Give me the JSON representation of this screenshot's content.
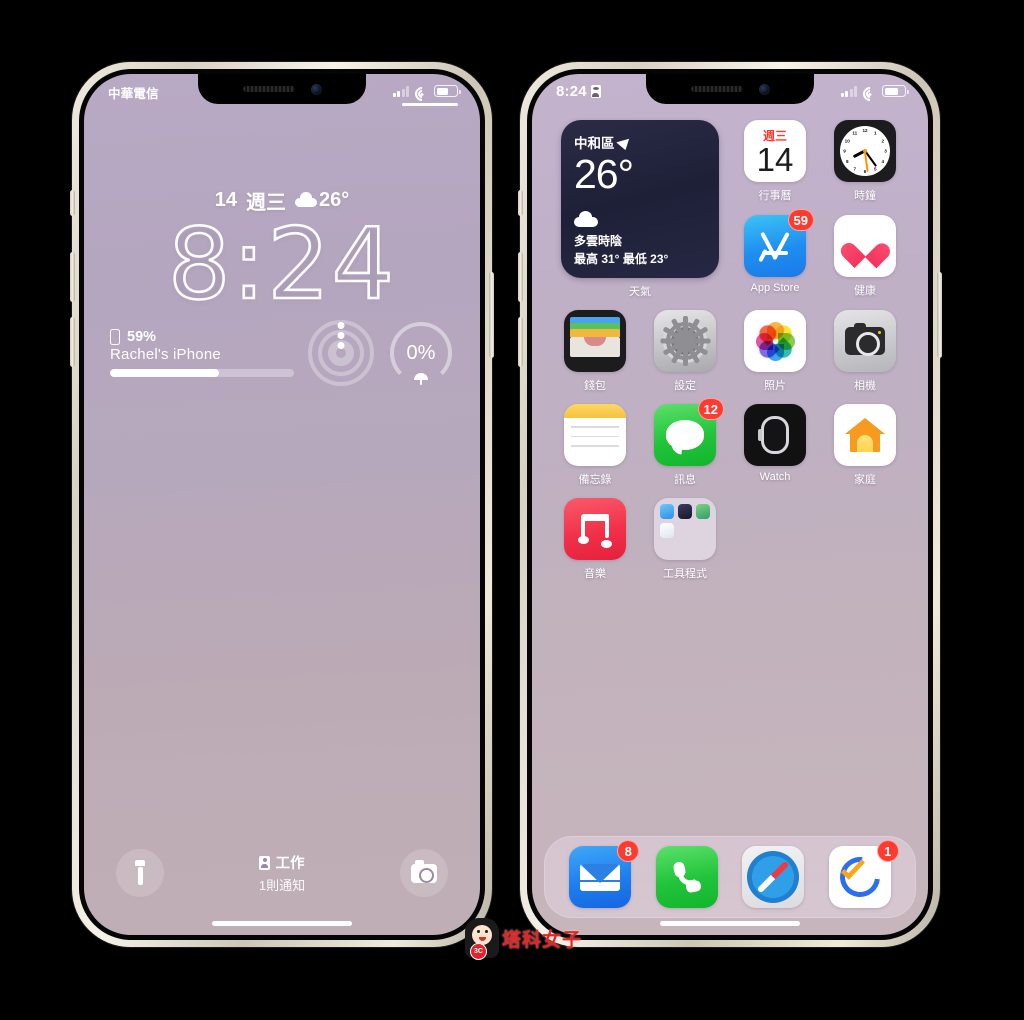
{
  "watermark": {
    "text": "塔科女子",
    "badge": "3C"
  },
  "lock_screen": {
    "status_bar": {
      "carrier": "中華電信",
      "battery_level_pct": 59
    },
    "date_line": {
      "day": "14",
      "weekday": "週三",
      "temp": "26°",
      "condition_icon": "cloud-icon"
    },
    "clock": "8:24",
    "widgets": {
      "battery": {
        "percent": "59%",
        "device_name": "Rachel's  iPhone",
        "fill_pct": 59
      },
      "rings": {
        "label": "activity-rings"
      },
      "rain": {
        "percent": "0%",
        "icon": "umbrella-icon"
      }
    },
    "bottom": {
      "flashlight_label": "flashlight",
      "camera_label": "camera",
      "focus_name": "工作",
      "notification_count_text": "1則通知"
    }
  },
  "home_screen": {
    "status_bar": {
      "time": "8:24",
      "lock_icon": "focus-lock-icon",
      "battery_level_pct": 72
    },
    "weather_widget": {
      "city": "中和區",
      "location_icon": "location-arrow-icon",
      "temperature": "26°",
      "condition_icon": "cloud-icon",
      "condition": "多雲時陰",
      "high_low": "最高 31° 最低 23°",
      "label": "天氣"
    },
    "rows": [
      [
        {
          "name": "calendar",
          "label": "行事曆",
          "weekday": "週三",
          "day": "14",
          "badge": null
        },
        {
          "name": "clock",
          "label": "時鐘",
          "badge": null
        }
      ],
      [
        {
          "name": "app-store",
          "label": "App Store",
          "badge": "59"
        },
        {
          "name": "health",
          "label": "健康",
          "badge": null
        }
      ],
      [
        {
          "name": "wallet",
          "label": "錢包",
          "badge": null
        },
        {
          "name": "settings",
          "label": "設定",
          "badge": null
        },
        {
          "name": "photos",
          "label": "照片",
          "badge": null
        },
        {
          "name": "camera",
          "label": "相機",
          "badge": null
        }
      ],
      [
        {
          "name": "notes",
          "label": "備忘錄",
          "badge": null
        },
        {
          "name": "messages",
          "label": "訊息",
          "badge": "12"
        },
        {
          "name": "watch",
          "label": "Watch",
          "badge": null
        },
        {
          "name": "home",
          "label": "家庭",
          "badge": null
        }
      ],
      [
        {
          "name": "music",
          "label": "音樂",
          "badge": null
        },
        {
          "name": "utilities-folder",
          "label": "工具程式",
          "badge": null
        }
      ]
    ],
    "dock": [
      {
        "name": "mail",
        "label": "Mail",
        "badge": "8"
      },
      {
        "name": "phone",
        "label": "Phone",
        "badge": null
      },
      {
        "name": "safari",
        "label": "Safari",
        "badge": null
      },
      {
        "name": "reminders",
        "label": "Reminders",
        "badge": "1"
      }
    ]
  },
  "colors": {
    "lock_bg_top": "#b8a9c4",
    "lock_bg_bottom": "#c0aeb6",
    "home_bg_top": "#c3b3cd",
    "home_bg_bottom": "#c6b5bb",
    "badge_red": "#fe3b30",
    "frame": "#efeade"
  }
}
